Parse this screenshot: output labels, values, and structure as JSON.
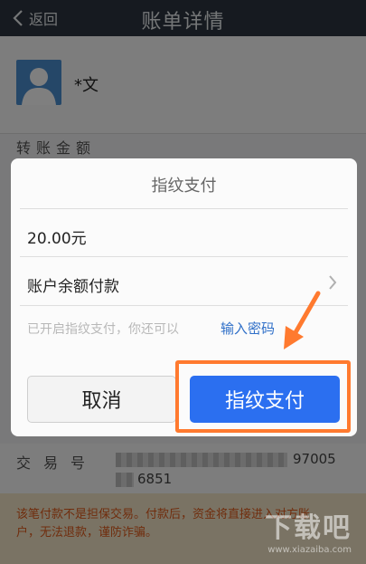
{
  "header": {
    "back_label": "返回",
    "title": "账单详情"
  },
  "payee": {
    "name": "*文"
  },
  "detail": {
    "amount_label": "转账金额",
    "tx_label": "交易号",
    "tx_value_tail": "97005",
    "tx_value_line2_tail": "6851"
  },
  "warning": {
    "text": "该笔付款不是担保交易。付款后，资金将直接进入对方账户，无法退款，谨防诈骗。"
  },
  "dialog": {
    "title": "指纹支付",
    "amount": "20.00元",
    "method": "账户余额付款",
    "hint": "已开启指纹支付，你还可以",
    "link": "输入密码",
    "cancel_label": "取消",
    "pay_label": "指纹支付"
  },
  "watermark": {
    "big": "下载吧",
    "small": "www.xiazaiba.com"
  },
  "colors": {
    "header_bg": "#2d3540",
    "primary": "#2b6ff0",
    "link": "#2f6fc8",
    "annotation": "#ff7a2f",
    "warning_text": "#e05a1b"
  }
}
